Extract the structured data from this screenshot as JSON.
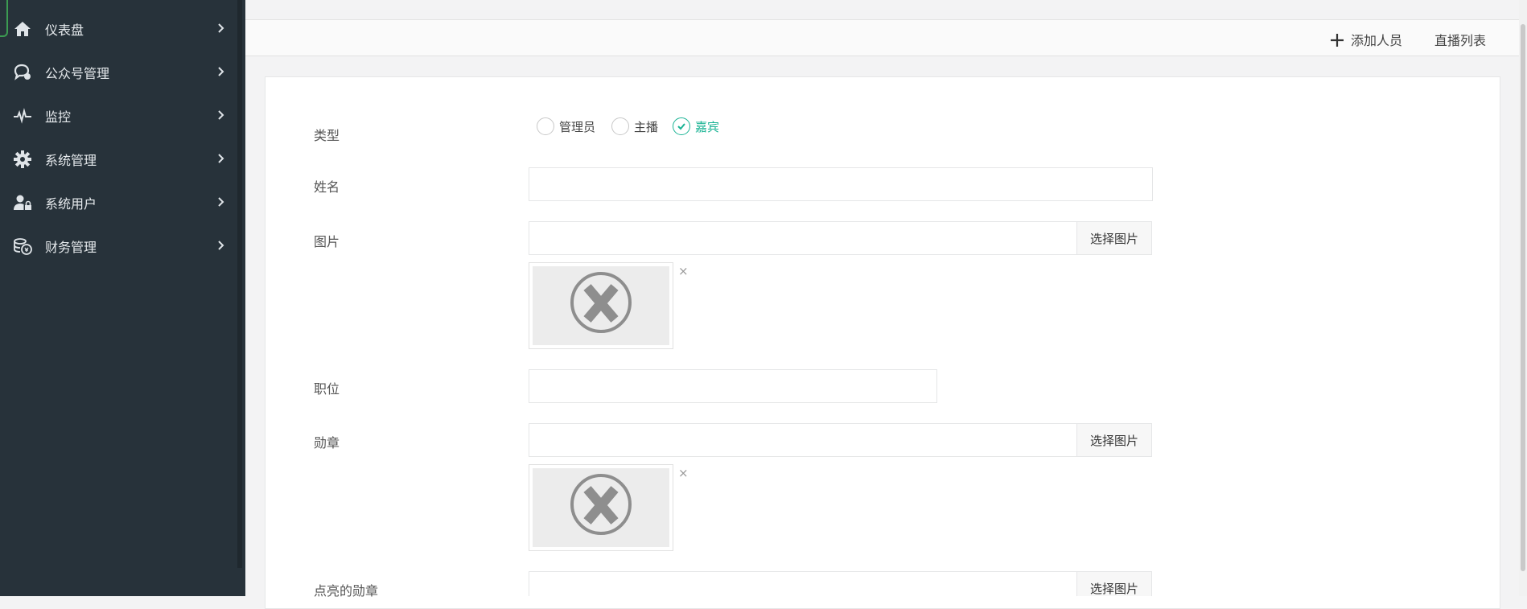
{
  "sidebar": {
    "items": [
      {
        "label": "仪表盘",
        "icon": "home-icon"
      },
      {
        "label": "公众号管理",
        "icon": "chat-icon"
      },
      {
        "label": "监控",
        "icon": "pulse-icon"
      },
      {
        "label": "系统管理",
        "icon": "gear-icon"
      },
      {
        "label": "系统用户",
        "icon": "user-lock-icon"
      },
      {
        "label": "财务管理",
        "icon": "money-icon"
      }
    ]
  },
  "toolbar": {
    "add_label": "添加人员",
    "list_label": "直播列表"
  },
  "form": {
    "type_label": "类型",
    "type_options": [
      "管理员",
      "主播",
      "嘉宾"
    ],
    "type_selected": "嘉宾",
    "name_label": "姓名",
    "name_value": "",
    "image_label": "图片",
    "image_value": "",
    "image_button": "选择图片",
    "position_label": "职位",
    "position_value": "",
    "medal_label": "勋章",
    "medal_value": "",
    "medal_button": "选择图片",
    "lit_medal_label": "点亮的勋章",
    "lit_medal_value": "",
    "lit_medal_button": "选择图片",
    "remove_symbol": "×"
  },
  "colors": {
    "sidebar_bg": "#27323a",
    "accent_green": "#1ab394"
  }
}
